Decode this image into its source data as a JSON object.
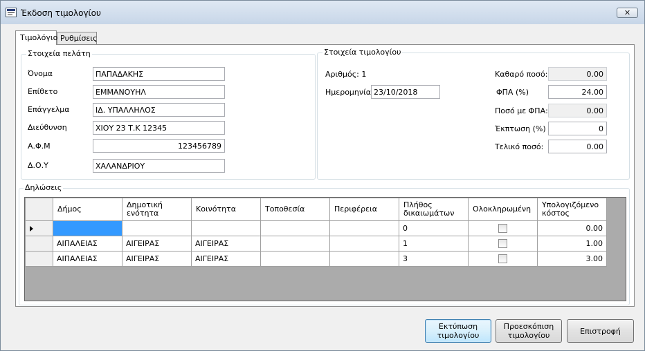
{
  "window": {
    "title": "Έκδοση τιμολογίου",
    "close_glyph": "✕"
  },
  "tabs": [
    {
      "label": "Τιμολόγιο",
      "active": true
    },
    {
      "label": "Ρυθμίσεις",
      "active": false
    }
  ],
  "customer": {
    "group_title": "Στοιχεία πελάτη",
    "fields": [
      {
        "label": "Όνομα",
        "value": "ΠΑΠΑΔΑΚΗΣ"
      },
      {
        "label": "Επίθετο",
        "value": "ΕΜΜΑΝΟΥΗΛ"
      },
      {
        "label": "Επάγγελμα",
        "value": "ΙΔ. ΥΠΑΛΛΗΛΟΣ"
      },
      {
        "label": "Διεύθυνση",
        "value": "ΧΙΟΥ 23 Τ.Κ 12345"
      },
      {
        "label": "Α.Φ.Μ",
        "value": "123456789"
      },
      {
        "label": "Δ.Ο.Υ",
        "value": "ΧΑΛΑΝΔΡΙΟΥ"
      }
    ]
  },
  "invoice": {
    "group_title": "Στοιχεία τιμολογίου",
    "number_label": "Αριθμός: 1",
    "date_label": "Ημερομηνία:",
    "date_value": "23/10/2018",
    "amounts": [
      {
        "label": "Καθαρό ποσό:",
        "value": "0.00",
        "readonly": true
      },
      {
        "label": "ΦΠΑ (%)",
        "value": "24.00",
        "readonly": false
      },
      {
        "label": "Ποσό με ΦΠΑ:",
        "value": "0.00",
        "readonly": true
      },
      {
        "label": "Έκπτωση (%)",
        "value": "0",
        "readonly": false
      },
      {
        "label": "Τελικό ποσό:",
        "value": "0.00",
        "readonly": false
      }
    ]
  },
  "declarations": {
    "group_title": "Δηλώσεις",
    "columns": [
      "Δήμος",
      "Δημοτική ενότητα",
      "Κοινότητα",
      "Τοποθεσία",
      "Περιφέρεια",
      "Πλήθος δικαιωμάτων",
      "Ολοκληρωμένη",
      "Υπολογιζόμενο κόστος"
    ],
    "rows": [
      {
        "dimos": "",
        "enotita": "",
        "koinotita": "",
        "topothesia": "",
        "perifereia": "",
        "plithos": "0",
        "completed": false,
        "kostos": "0.00"
      },
      {
        "dimos": "ΑΙΠΑΛΕΙΑΣ",
        "enotita": "ΑΙΓΕΙΡΑΣ",
        "koinotita": "ΑΙΓΕΙΡΑΣ",
        "topothesia": "",
        "perifereia": "",
        "plithos": "1",
        "completed": false,
        "kostos": "1.00"
      },
      {
        "dimos": "ΑΙΠΑΛΕΙΑΣ",
        "enotita": "ΑΙΓΕΙΡΑΣ",
        "koinotita": "ΑΙΓΕΙΡΑΣ",
        "topothesia": "",
        "perifereia": "",
        "plithos": "3",
        "completed": false,
        "kostos": "3.00"
      }
    ]
  },
  "buttons": {
    "print": "Εκτύπωση\nτιμολογίου",
    "preview": "Προεσκόπιση\nτιμολογίου",
    "back": "Επιστροφή"
  }
}
